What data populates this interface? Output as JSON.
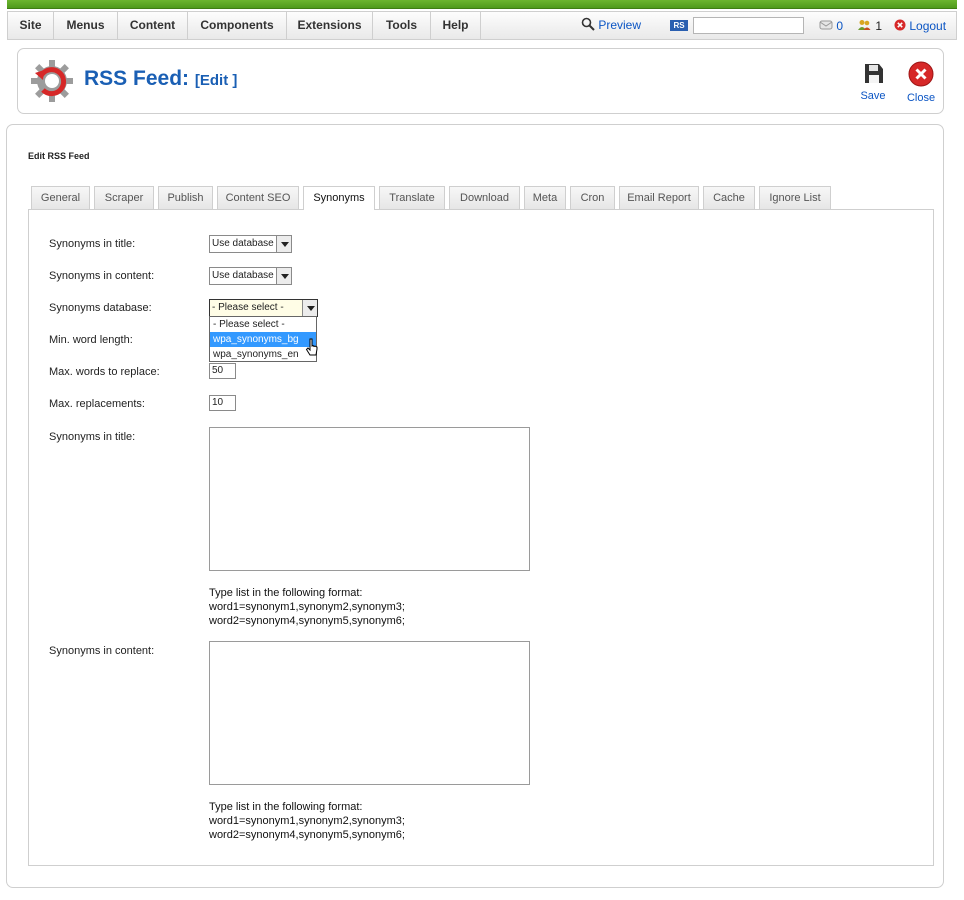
{
  "menu": [
    "Site",
    "Menus",
    "Content",
    "Components",
    "Extensions",
    "Tools",
    "Help"
  ],
  "topbar": {
    "preview_label": "Preview",
    "rs_badge": "RS",
    "search_value": "",
    "messages_count": "0",
    "users_count": "1",
    "logout_label": "Logout"
  },
  "header": {
    "title": "RSS Feed:",
    "subtitle": "[Edit ]",
    "save_label": "Save",
    "close_label": "Close"
  },
  "form_title": "Edit RSS Feed",
  "tabs": [
    "General",
    "Scraper",
    "Publish",
    "Content SEO",
    "Synonyms",
    "Translate",
    "Download",
    "Meta",
    "Cron",
    "Email Report",
    "Cache",
    "Ignore List"
  ],
  "active_tab": "Synonyms",
  "fields": {
    "syn_title_label": "Synonyms in title:",
    "syn_title_value": "Use database",
    "syn_content_label": "Synonyms in content:",
    "syn_content_value": "Use database",
    "syn_db_label": "Synonyms database:",
    "syn_db_value": "- Please select -",
    "syn_db_options": [
      "- Please select -",
      "wpa_synonyms_bg",
      "wpa_synonyms_en"
    ],
    "min_word_label": "Min. word length:",
    "max_words_label": "Max. words to replace:",
    "max_words_value": "50",
    "max_repl_label": "Max. replacements:",
    "max_repl_value": "10",
    "syn_title_list_label": "Synonyms in title:",
    "syn_content_list_label": "Synonyms in content:",
    "hint_line1": "Type list in the following format:",
    "hint_line2": "word1=synonym1,synonym2,synonym3;",
    "hint_line3": "word2=synonym4,synonym5,synonym6;"
  },
  "colors": {
    "accent": "#1a5fb4",
    "link": "#0b55c4",
    "topbar_green": "#5aa823",
    "dropdown_highlight": "#3399ff",
    "close_red": "#d62828"
  }
}
